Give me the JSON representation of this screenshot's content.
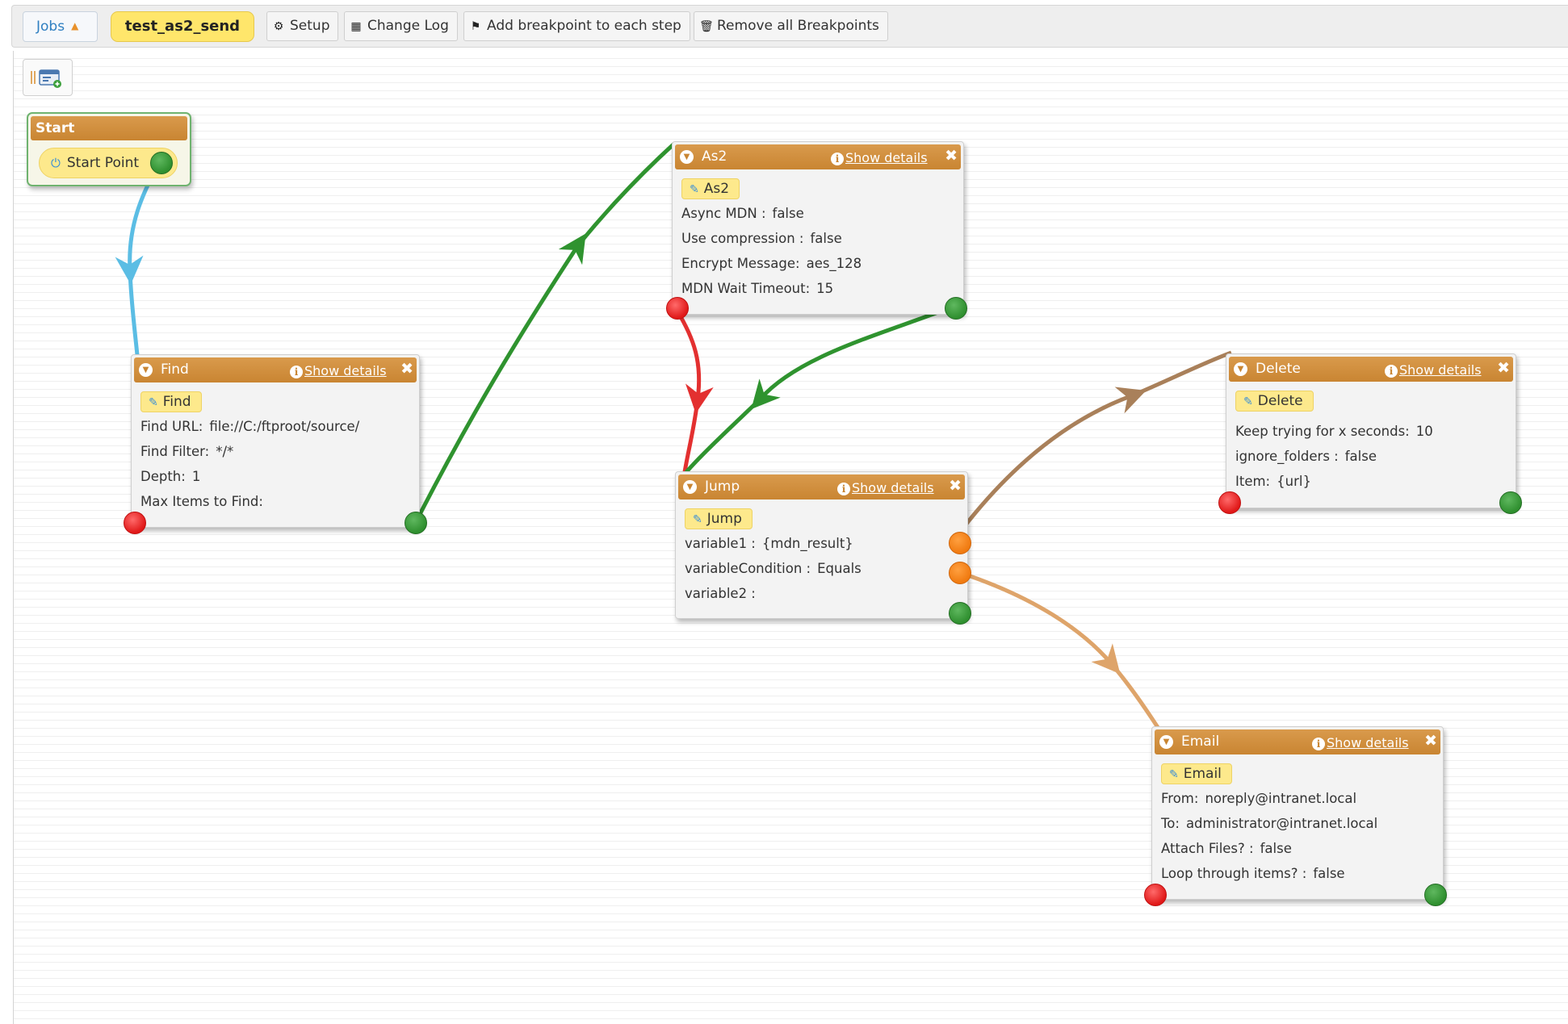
{
  "toolbar": {
    "jobs_label": "Jobs",
    "job_name": "test_as2_send",
    "buttons": [
      {
        "label": "Setup",
        "icon": "gear-icon"
      },
      {
        "label": "Change Log",
        "icon": "calendar-icon"
      },
      {
        "label": "Add breakpoint to each step",
        "icon": "flag-icon"
      },
      {
        "label": "Remove all Breakpoints",
        "icon": "trash-icon"
      }
    ]
  },
  "palette": {
    "icon": "add-step-palette-icon"
  },
  "start": {
    "title": "Start",
    "point_label": "Start Point"
  },
  "details_label": "Show details",
  "nodes": {
    "find": {
      "title": "Find",
      "chip": "Find",
      "props": [
        {
          "k": "Find URL:",
          "v": "file://C:/ftproot/source/"
        },
        {
          "k": "Find Filter:",
          "v": "*/*"
        },
        {
          "k": "Depth:",
          "v": "1"
        },
        {
          "k": "Max Items to Find:",
          "v": ""
        }
      ]
    },
    "as2": {
      "title": "As2",
      "chip": "As2",
      "props": [
        {
          "k": "Async MDN :",
          "v": "false"
        },
        {
          "k": "Use compression :",
          "v": "false"
        },
        {
          "k": "Encrypt Message:",
          "v": "aes_128"
        },
        {
          "k": "MDN Wait Timeout:",
          "v": "15"
        }
      ]
    },
    "jump": {
      "title": "Jump",
      "chip": "Jump",
      "props": [
        {
          "k": "variable1 :",
          "v": "{mdn_result}"
        },
        {
          "k": "variableCondition :",
          "v": "Equals"
        },
        {
          "k": "variable2 :",
          "v": ""
        }
      ]
    },
    "delete": {
      "title": "Delete",
      "chip": "Delete",
      "props": [
        {
          "k": "Keep trying for x seconds:",
          "v": "10"
        },
        {
          "k": "ignore_folders :",
          "v": "false"
        },
        {
          "k": "Item:",
          "v": "{url}"
        }
      ]
    },
    "email": {
      "title": "Email",
      "chip": "Email",
      "props": [
        {
          "k": "From:",
          "v": "noreply@intranet.local"
        },
        {
          "k": "To:",
          "v": "administrator@intranet.local"
        },
        {
          "k": "Attach Files? :",
          "v": "false"
        },
        {
          "k": "Loop through items? :",
          "v": "false"
        }
      ]
    }
  },
  "colors": {
    "header": "#c98532",
    "start_link": "#5bbde4",
    "success_link": "#2f932f",
    "error_link": "#e33030",
    "jump_true_link": "#a9805a",
    "jump_false_link": "#dea46a"
  }
}
